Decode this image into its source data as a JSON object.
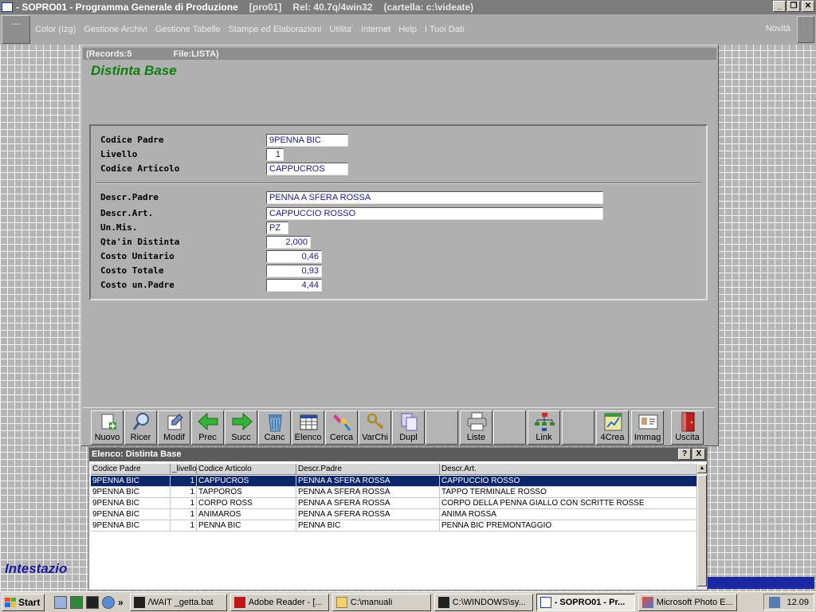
{
  "window": {
    "title": "- SOPRO01 - Programma Generale di Produzione",
    "code": "[pro01]",
    "release": "Rel: 40.7q/4win32",
    "folder": "(cartella: c:\\videate)"
  },
  "menu": {
    "items": [
      "Color (Izg)",
      "Gestione Archivi",
      "Gestione Tabelle",
      "Stampe ed Elaborazioni",
      "Utilita'",
      "Internet",
      "Help",
      "I Tuoi Dati"
    ],
    "right": "Novità"
  },
  "form": {
    "records": "(Records:5",
    "file": "File:LISTA)",
    "title": "Distinta Base",
    "fields": {
      "codice_padre": {
        "label": "Codice Padre",
        "value": "9PENNA BIC"
      },
      "livello": {
        "label": "Livello",
        "value": "1"
      },
      "codice_articolo": {
        "label": "Codice Articolo",
        "value": "CAPPUCROS"
      },
      "descr_padre": {
        "label": "Descr.Padre",
        "value": "PENNA A SFERA ROSSA"
      },
      "descr_art": {
        "label": "Descr.Art.",
        "value": "CAPPUCCIO ROSSO"
      },
      "un_mis": {
        "label": "Un.Mis.",
        "value": "PZ"
      },
      "qta": {
        "label": "Qta'in Distinta",
        "value": "2,000"
      },
      "costo_unitario": {
        "label": "Costo Unitario",
        "value": "0,46"
      },
      "costo_totale": {
        "label": "Costo Totale",
        "value": "0,93"
      },
      "costo_padre": {
        "label": "Costo un.Padre",
        "value": "4,44"
      }
    }
  },
  "toolbar": {
    "nuovo": "Nuovo",
    "ricer": "Ricer",
    "modif": "Modif",
    "prec": "Prec",
    "succ": "Succ",
    "canc": "Canc",
    "elenco": "Elenco",
    "cerca": "Cerca",
    "varchi": "VarChi",
    "dupl": "Dupl",
    "liste": "Liste",
    "link": "Link",
    "crea": "4Crea",
    "immag": "Immag",
    "uscita": "Uscita"
  },
  "list": {
    "title": "Elenco: Distinta Base",
    "help": "?",
    "close": "X",
    "columns": [
      "Codice Padre",
      "_livello",
      "Codice Articolo",
      "Descr.Padre",
      "Descr.Art."
    ],
    "rows": [
      [
        "9PENNA BIC",
        "1",
        "CAPPUCROS",
        "PENNA A SFERA ROSSA",
        "CAPPUCCIO ROSSO"
      ],
      [
        "9PENNA BIC",
        "1",
        "TAPPOROS",
        "PENNA A SFERA ROSSA",
        "TAPPO TERMINALE ROSSO"
      ],
      [
        "9PENNA BIC",
        "1",
        "CORPO ROSS",
        "PENNA A SFERA ROSSA",
        "CORPO DELLA PENNA GIALLO CON SCRITTE ROSSE"
      ],
      [
        "9PENNA BIC",
        "1",
        "ANIMAROS",
        "PENNA A SFERA ROSSA",
        "ANIMA ROSSA"
      ],
      [
        "9PENNA BIC",
        "1",
        "PENNA BIC",
        "PENNA BIC",
        "PENNA BIC PREMONTAGGIO"
      ]
    ]
  },
  "background": {
    "intestazione": "Intestazio"
  },
  "taskbar": {
    "start": "Start",
    "tasks": [
      "/WAIT _getta.bat",
      "Adobe Reader - [...",
      "C:\\manuali",
      "C:\\WINDOWS\\sy...",
      "- SOPRO01 - Pr...",
      "Microsoft Photo E..."
    ],
    "clock": "12.09"
  },
  "colors": {
    "selected_row": "#0c2669",
    "form_title": "#0f7d0f",
    "field_text": "#1a1a80",
    "intestazione": "#1a1aa0"
  }
}
